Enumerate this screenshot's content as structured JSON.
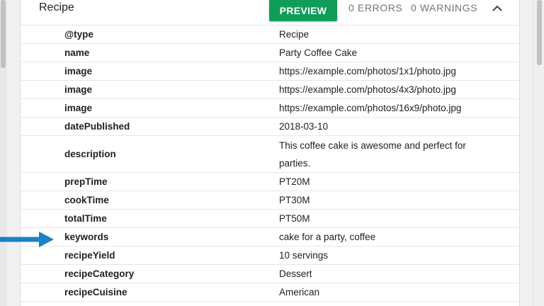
{
  "card": {
    "title": "Recipe",
    "preview_label": "PREVIEW",
    "errors_label": "0 ERRORS",
    "warnings_label": "0 WARNINGS"
  },
  "rows": [
    {
      "property": "@type",
      "value": "Recipe"
    },
    {
      "property": "name",
      "value": "Party Coffee Cake"
    },
    {
      "property": "image",
      "value": "https://example.com/photos/1x1/photo.jpg"
    },
    {
      "property": "image",
      "value": "https://example.com/photos/4x3/photo.jpg"
    },
    {
      "property": "image",
      "value": "https://example.com/photos/16x9/photo.jpg"
    },
    {
      "property": "datePublished",
      "value": "2018-03-10"
    },
    {
      "property": "description",
      "value": "This coffee cake is awesome and perfect for parties."
    },
    {
      "property": "prepTime",
      "value": "PT20M"
    },
    {
      "property": "cookTime",
      "value": "PT30M"
    },
    {
      "property": "totalTime",
      "value": "PT50M"
    },
    {
      "property": "keywords",
      "value": "cake for a party, coffee"
    },
    {
      "property": "recipeYield",
      "value": "10 servings"
    },
    {
      "property": "recipeCategory",
      "value": "Dessert"
    },
    {
      "property": "recipeCuisine",
      "value": "American"
    }
  ],
  "colors": {
    "preview_button": "#0f9d58",
    "highlight_arrow": "#1a82c4"
  },
  "icons": {
    "collapse": "chevron-up-icon",
    "highlight": "arrow-right-icon"
  }
}
